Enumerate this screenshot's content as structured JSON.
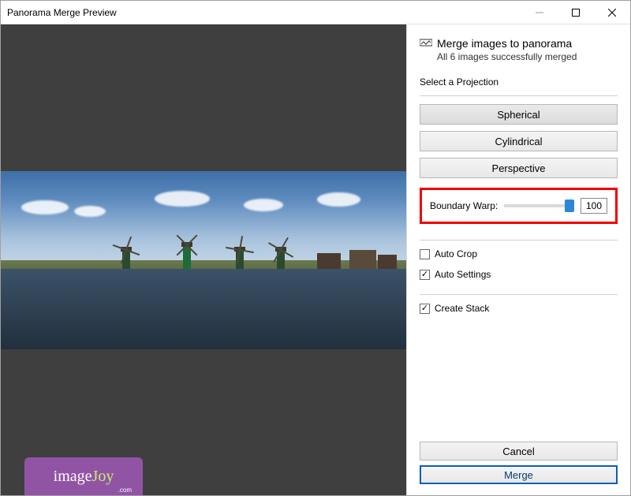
{
  "window": {
    "title": "Panorama Merge Preview"
  },
  "panel": {
    "heading": "Merge images to panorama",
    "status": "All 6 images successfully merged",
    "projection_label": "Select a Projection",
    "projections": {
      "spherical": "Spherical",
      "cylindrical": "Cylindrical",
      "perspective": "Perspective"
    },
    "boundary_warp": {
      "label": "Boundary Warp:",
      "value": "100",
      "percent": 100
    },
    "checks": {
      "auto_crop": "Auto Crop",
      "auto_settings": "Auto Settings",
      "create_stack": "Create Stack"
    },
    "check_state": {
      "auto_crop": false,
      "auto_settings": true,
      "create_stack": true
    },
    "buttons": {
      "cancel": "Cancel",
      "merge": "Merge"
    }
  },
  "logo": {
    "text_image": "image",
    "text_joy": "Joy",
    "sub": ".com"
  }
}
